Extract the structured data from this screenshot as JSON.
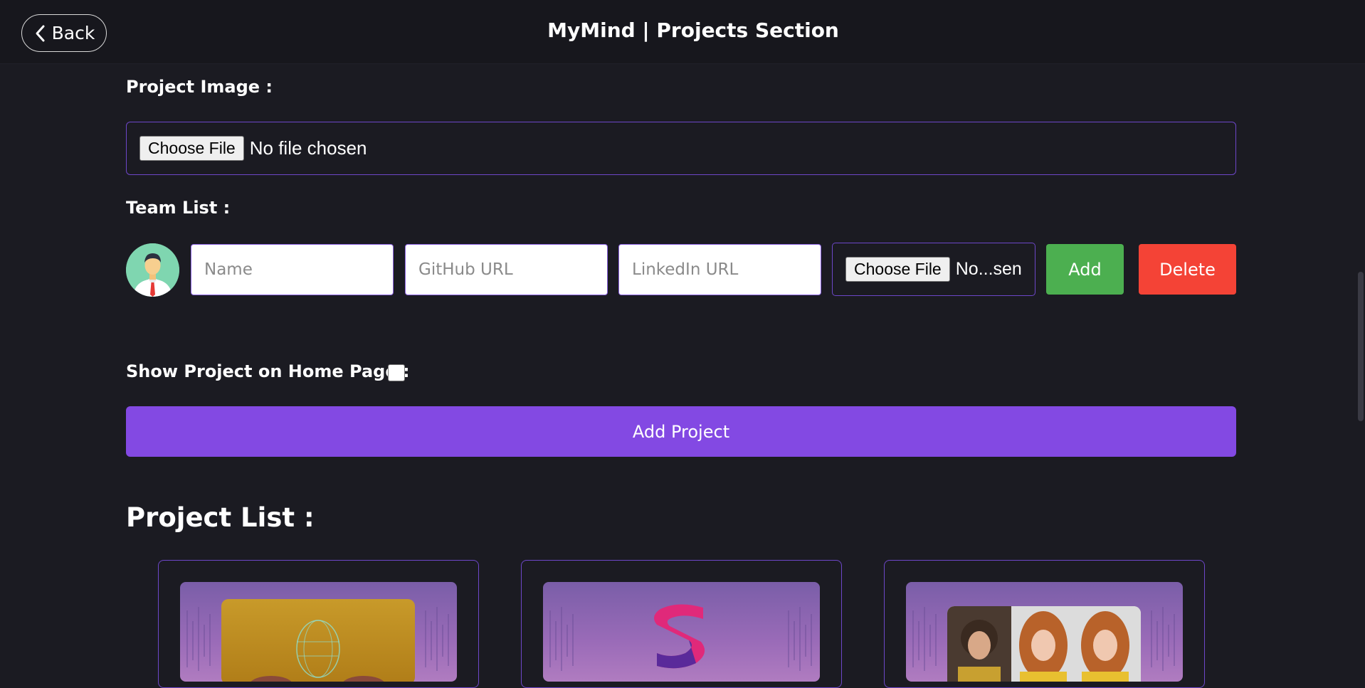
{
  "header": {
    "back_label": "Back",
    "title": "MyMind | Projects Section"
  },
  "form": {
    "project_image_label": "Project Image :",
    "choose_file_label": "Choose File",
    "no_file_chosen": "No file chosen",
    "team_list_label": "Team List :",
    "team": {
      "name_placeholder": "Name",
      "github_placeholder": "GitHub URL",
      "linkedin_placeholder": "LinkedIn URL",
      "choose_file_label": "Choose File",
      "file_status": "No...sen",
      "add_label": "Add",
      "delete_label": "Delete"
    },
    "show_on_home_label": "Show Project on Home Page :",
    "show_on_home_checked": false,
    "add_project_label": "Add Project"
  },
  "project_list": {
    "title": "Project List :",
    "cards": [
      {
        "icon": "ai-face-thumbnail"
      },
      {
        "icon": "s-logo-thumbnail"
      },
      {
        "icon": "people-photo-thumbnail"
      }
    ]
  },
  "colors": {
    "background": "#1b1b22",
    "accent": "#8349e3",
    "border": "#6d47c9",
    "add": "#4caf50",
    "delete": "#f44336"
  }
}
